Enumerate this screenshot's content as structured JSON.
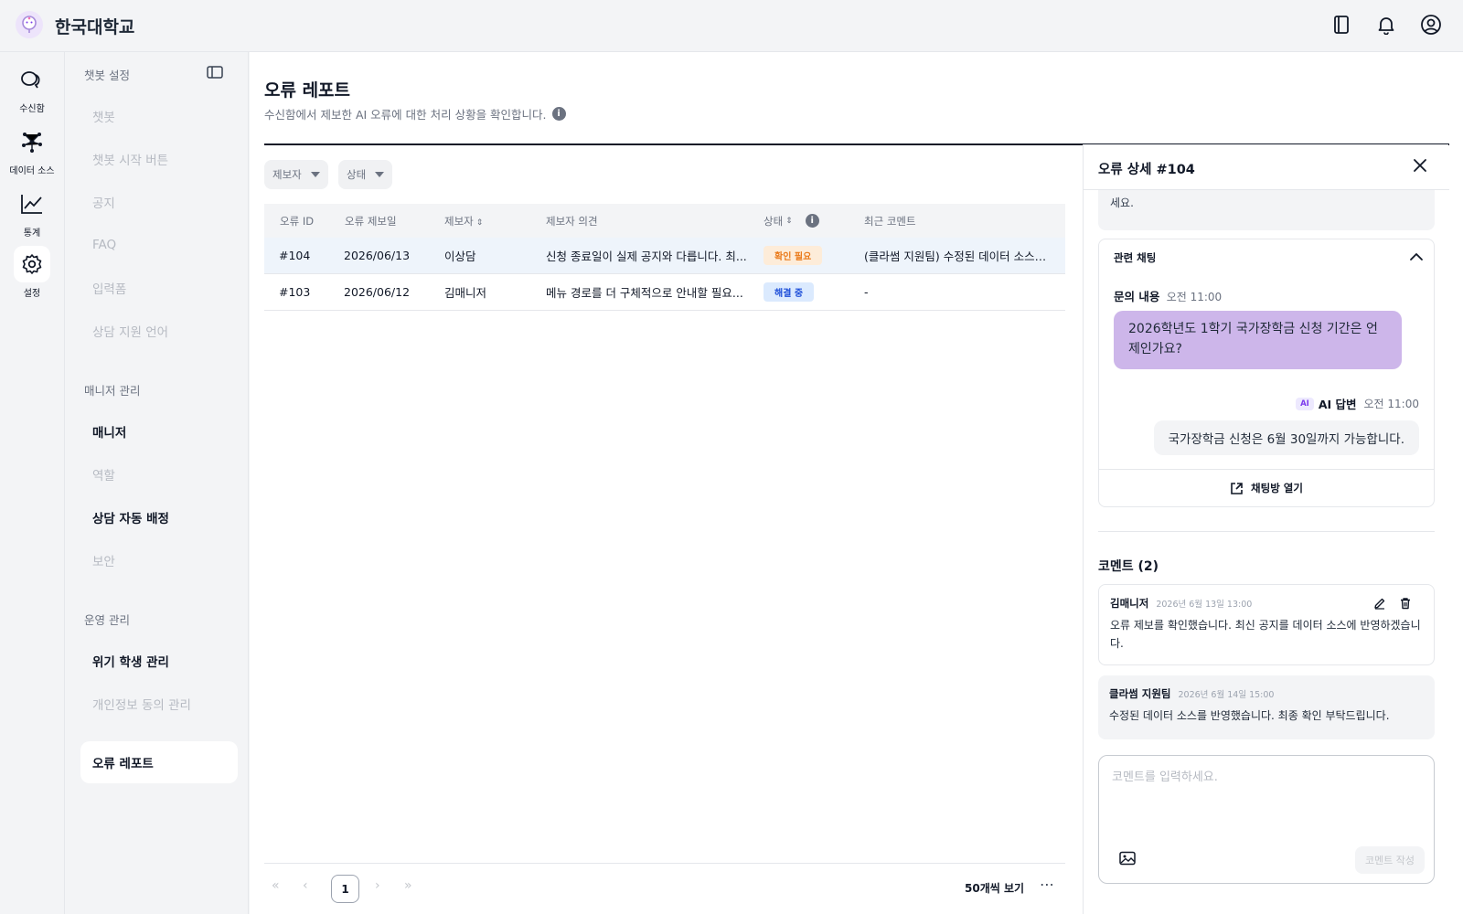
{
  "app": {
    "org_name": "한국대학교"
  },
  "rail": [
    {
      "label": "수신함",
      "icon": "inbox-chat-icon"
    },
    {
      "label": "데이터 소스",
      "icon": "network-icon"
    },
    {
      "label": "통계",
      "icon": "chart-line-icon"
    },
    {
      "label": "설정",
      "icon": "gear-icon",
      "active": true
    }
  ],
  "sidebar": {
    "section_chatbot": "챗봇 설정",
    "chatbot_items": [
      "챗봇",
      "챗봇 시작 버튼",
      "공지",
      "FAQ",
      "입력폼",
      "상담 지원 언어"
    ],
    "section_manager": "매니저 관리",
    "manager_items": [
      "매니저",
      "역할",
      "상담 자동 배정",
      "보안"
    ],
    "section_ops": "운영 관리",
    "ops_items": [
      "위기 학생 관리",
      "개인정보 동의 관리",
      "오류 레포트"
    ]
  },
  "page": {
    "title": "오류 레포트",
    "description": "수신함에서 제보한 AI 오류에 대한 처리 상황을 확인합니다."
  },
  "filters": {
    "reporter": "제보자",
    "status": "상태"
  },
  "table": {
    "headers": [
      "오류 ID",
      "오류 제보일",
      "제보자",
      "제보자 의견",
      "상태",
      "최근 코멘트"
    ],
    "rows": [
      {
        "id": "#104",
        "date": "2026/06/13",
        "reporter": "이상담",
        "opinion": "신청 종료일이 실제 공지와 다릅니다. 최...",
        "status": "확인 필요",
        "comment": "(클라썸 지원팀) 수정된 데이터 소스를 ..."
      },
      {
        "id": "#103",
        "date": "2026/06/12",
        "reporter": "김매니저",
        "opinion": "메뉴 경로를 더 구체적으로 안내할 필요...",
        "status": "해결 중",
        "comment": "-"
      }
    ]
  },
  "pager": {
    "current": "1",
    "page_size": "50개씩 보기"
  },
  "detail": {
    "title": "오류 상세 #104",
    "prev_text_tail": "세요.",
    "related_chat_title": "관련 채팅",
    "question_label": "문의 내용",
    "question_time": "오전 11:00",
    "question_text": "2026학년도 1학기 국가장학금 신청 기간은 언제인가요?",
    "ai_chip": "AI",
    "answer_label": "AI 답변",
    "answer_time": "오전 11:00",
    "answer_text": "국가장학금 신청은 6월 30일까지 가능합니다.",
    "open_room": "채팅방 열기",
    "comments_title": "코멘트 (2)",
    "comments": [
      {
        "author": "김매니저",
        "date": "2026년 6월 13일 13:00",
        "text": "오류 제보를 확인했습니다. 최신 공지를 데이터 소스에 반영하겠습니다."
      },
      {
        "author": "클라썸 지원팀",
        "date": "2026년 6월 14일 15:00",
        "text": "수정된 데이터 소스를 반영했습니다. 최종 확인 부탁드립니다."
      }
    ],
    "input_placeholder": "코멘트를 입력하세요.",
    "submit_label": "코멘트 작성"
  }
}
